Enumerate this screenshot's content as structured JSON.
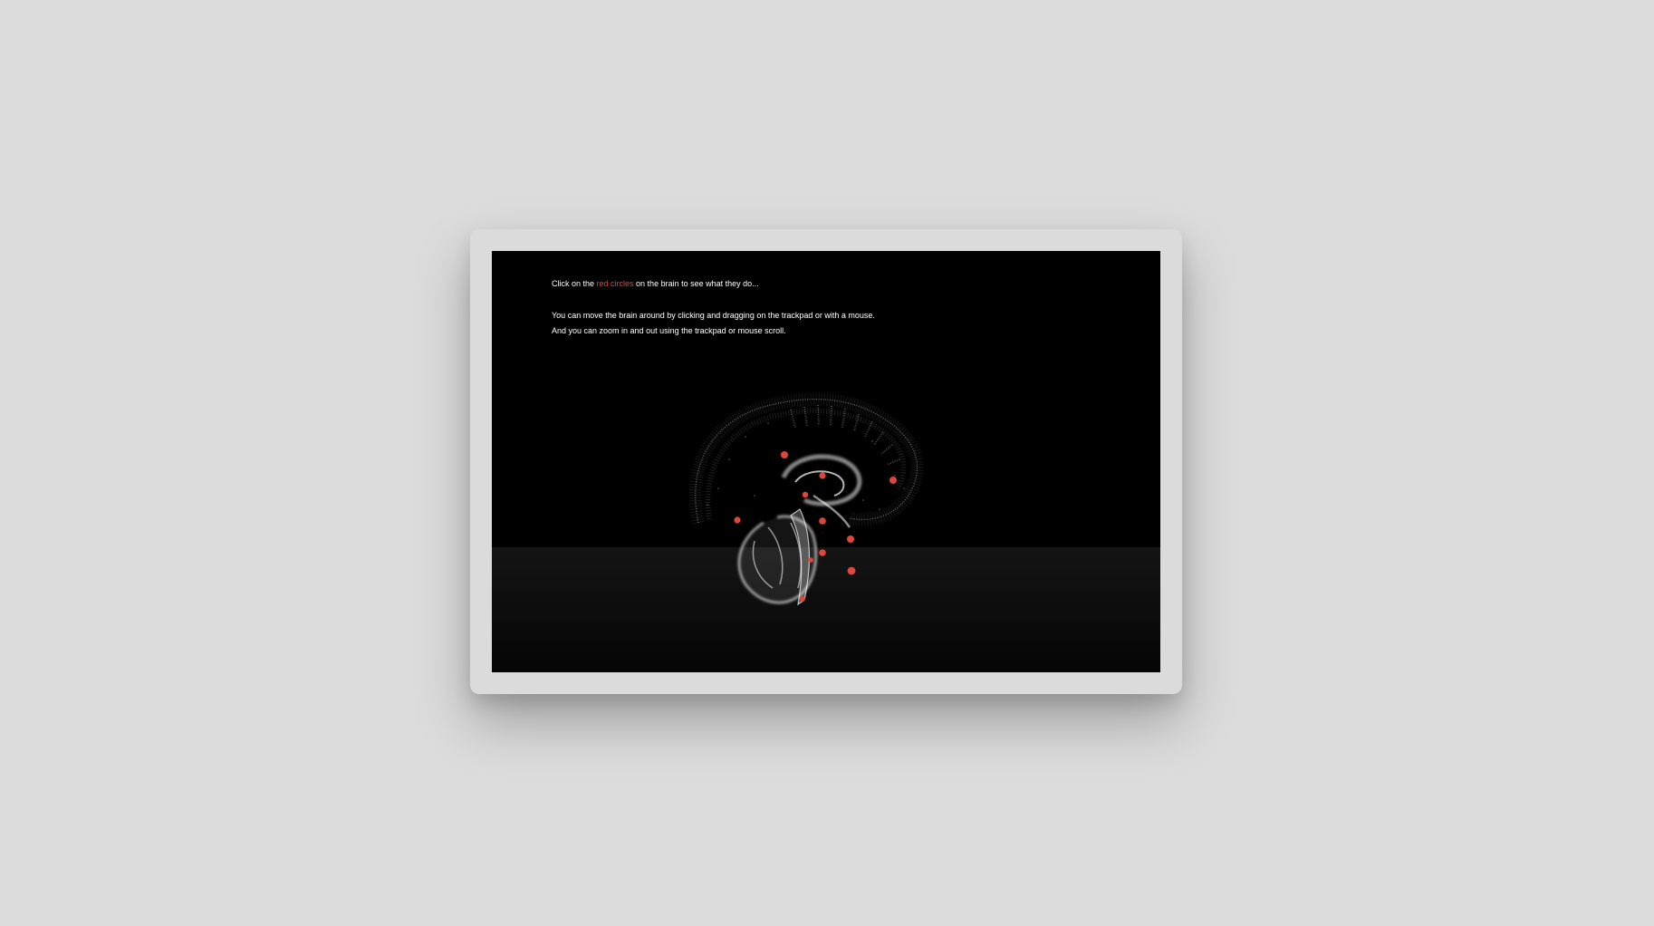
{
  "instructions": {
    "line1_prefix": "Click on the ",
    "line1_highlight": "red circles",
    "line1_suffix": " on the brain to see what they do...",
    "line2": "You can move the brain around by clicking and dragging on the trackpad or with a mouse.",
    "line3": "And you can zoom in and out using the trackpad or mouse scroll."
  },
  "colors": {
    "page_background": "#dcdcdc",
    "frame": "#dbdbdb",
    "screen_background": "#000000",
    "highlight_red": "#e1463d"
  },
  "brain": {
    "icon": "brain-point-cloud",
    "hotspot_count": 11
  }
}
